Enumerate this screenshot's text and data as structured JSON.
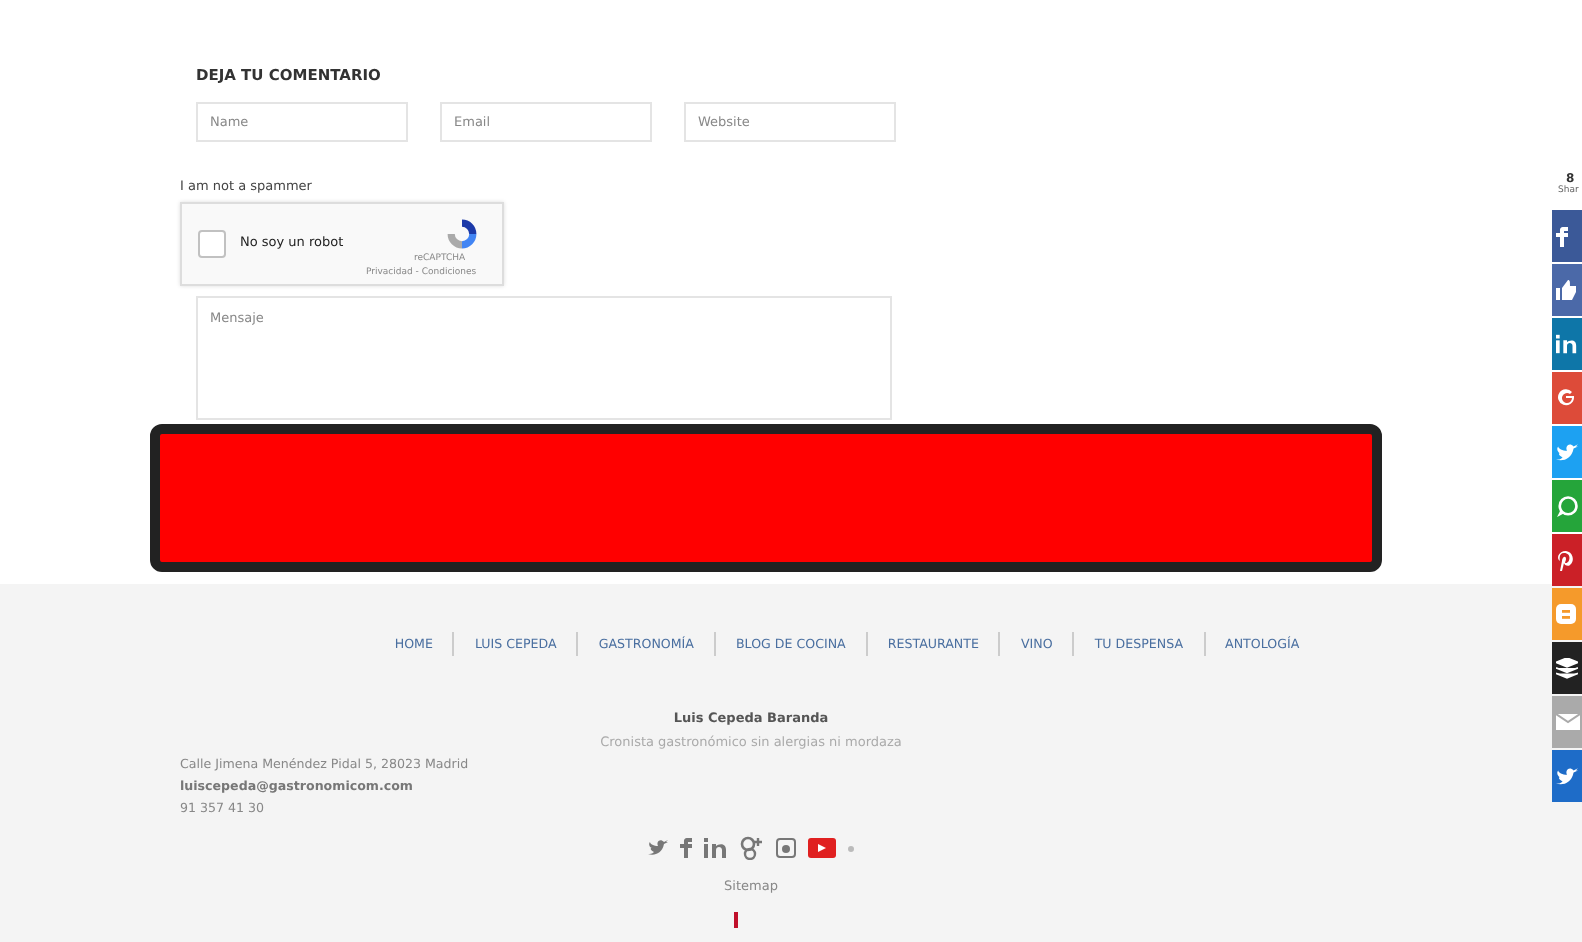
{
  "comment_form": {
    "title": "DEJA TU COMENTARIO",
    "fields": [
      {
        "placeholder": "Name"
      },
      {
        "placeholder": "Email"
      },
      {
        "placeholder": "Website"
      }
    ],
    "spam_label": "I am not a spammer",
    "captcha": {
      "label": "No soy un robot",
      "checked": false,
      "brand": "reCAPTCHA",
      "links": "Privacidad - Condiciones"
    },
    "message": {
      "placeholder": "Mensaje"
    }
  },
  "redaction": {
    "color": "#ff0000"
  },
  "footer": {
    "nav": [
      {
        "label": "HOME"
      },
      {
        "label": "LUIS CEPEDA"
      },
      {
        "label": "GASTRONOMÍA"
      },
      {
        "label": "BLOG DE COCINA"
      },
      {
        "label": "RESTAURANTE"
      },
      {
        "label": "VINO"
      },
      {
        "label": "TU DESPENSA"
      },
      {
        "label": "ANTOLOGÍA"
      }
    ],
    "author": "Luis Cepeda Baranda",
    "tagline": "Cronista gastronómico sin alergias ni mordaza",
    "address": "Calle Jimena Menéndez Pidal 5, 28023 Madrid",
    "email": "luiscepeda@gastronomicom.com",
    "phone": "91 357 41 30",
    "social": [
      {
        "kind": "twitter"
      },
      {
        "kind": "facebook"
      },
      {
        "kind": "linkedin"
      },
      {
        "kind": "googleplus"
      },
      {
        "kind": "instagram"
      },
      {
        "kind": "youtube"
      },
      {
        "kind": "dot"
      }
    ],
    "sitemap": "Sitemap"
  },
  "share_bar": {
    "count": "8",
    "label": "Shar",
    "buttons": [
      {
        "kind": "facebook",
        "color": "#3b5998"
      },
      {
        "kind": "like",
        "color": "#4b69a8"
      },
      {
        "kind": "linkedin",
        "color": "#0e76a8"
      },
      {
        "kind": "googleplus",
        "color": "#dd4b39"
      },
      {
        "kind": "twitter",
        "color": "#1da1f2"
      },
      {
        "kind": "whatsapp",
        "color": "#25a53a"
      },
      {
        "kind": "pinterest",
        "color": "#cb2027"
      },
      {
        "kind": "blogger",
        "color": "#f59a2b"
      },
      {
        "kind": "buffer",
        "color": "#222222"
      },
      {
        "kind": "email",
        "color": "#aaaaaa"
      },
      {
        "kind": "bird",
        "color": "#1e6cc8"
      }
    ]
  }
}
